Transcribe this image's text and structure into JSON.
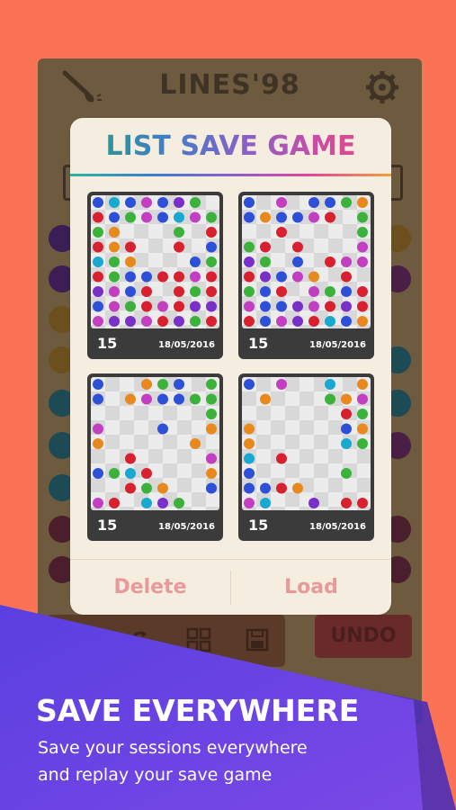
{
  "game": {
    "title": "LINES'98",
    "undo_label": "UNDO",
    "icons": [
      "brush-icon",
      "gear-icon",
      "restart-icon",
      "grid-icon",
      "save-icon"
    ],
    "colors": {
      "board_bg": "#6e5a3f",
      "undo_bg": "#6b2a2a"
    }
  },
  "dialog": {
    "title": "LIST SAVE GAME",
    "saves": [
      {
        "score": "15",
        "date": "18/05/2016"
      },
      {
        "score": "15",
        "date": "18/05/2016"
      },
      {
        "score": "15",
        "date": "18/05/2016"
      },
      {
        "score": "15",
        "date": "18/05/2016"
      }
    ],
    "delete_label": "Delete",
    "load_label": "Load"
  },
  "promo": {
    "heading": "SAVE EVERYWHERE",
    "line1": "Save your sessions everywhere",
    "line2": "and replay your save game",
    "colors": {
      "background": "#FA7355",
      "banner": "#6A45E8",
      "action_text": "#E79A9A"
    }
  }
}
